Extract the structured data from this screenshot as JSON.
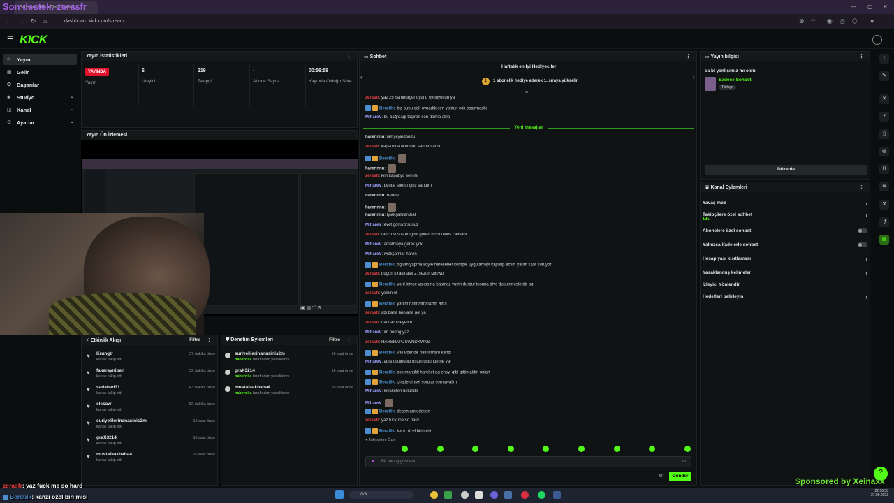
{
  "browser": {
    "tab_title": "Stream - Kick Dashboard",
    "overlay_title": "Son destek: zerasfr",
    "url": "dashboard.kick.com/stream"
  },
  "sidebar": {
    "items": [
      {
        "label": "Yayın"
      },
      {
        "label": "Gelir"
      },
      {
        "label": "Başarılar"
      },
      {
        "label": "Stüdyo"
      },
      {
        "label": "Kanal"
      },
      {
        "label": "Ayarlar"
      }
    ]
  },
  "stats": {
    "title": "Yayın İstatistikleri",
    "live_badge": "YAYINDA",
    "stream_label": "Yayın",
    "viewers_value": "6",
    "viewers_label": "İzleyici",
    "followers_value": "219",
    "followers_label": "Takipçi",
    "subs_value": "-",
    "subs_label": "Abone Sayısı",
    "uptime_value": "00:56:58",
    "uptime_label": "Yayında Olduğu Süre"
  },
  "preview": {
    "title": "Yayın Ön İzlemesi"
  },
  "activity": {
    "title": "Etkinlik Akışı",
    "filter": "Filtre",
    "items": [
      {
        "name": "Krungtr",
        "sub": "kanalı takip etti",
        "time": "37 dakika önce"
      },
      {
        "name": "fakerayniben",
        "sub": "kanalı takip etti",
        "time": "39 dakika önce"
      },
      {
        "name": "sadabed31",
        "sub": "kanalı takip etti",
        "time": "43 dakika önce"
      },
      {
        "name": "clesaw",
        "sub": "kanalı takip etti",
        "time": "52 dakika önce"
      },
      {
        "name": "suriyelilerinanasinis2m",
        "sub": "kanalı takip etti",
        "time": "16 saat önce"
      },
      {
        "name": "graX3214",
        "sub": "kanalı takip etti",
        "time": "16 saat önce"
      },
      {
        "name": "mustafaakbaba4",
        "sub": "kanalı takip etti",
        "time": "16 saat önce"
      }
    ]
  },
  "moderation": {
    "title": "Denetim Eylemleri",
    "filter": "Filtre",
    "items": [
      {
        "name": "suriyelilerinanasinis2m",
        "by": "naberdila",
        "action": "tarafından yasaklandı",
        "time": "16 saat önce"
      },
      {
        "name": "graX3214",
        "by": "naberdila",
        "action": "tarafından yasaklandı",
        "time": "16 saat önce"
      },
      {
        "name": "mustafaakbaba4",
        "by": "naberdila",
        "action": "tarafından yasaklandı",
        "time": "16 saat önce"
      }
    ]
  },
  "chat": {
    "title": "Sohbet",
    "top_gifters_title": "Haftalık en İyi Hediyeciler",
    "top_gifters_sub": "1 abonelik hediye ederek 1. sıraya yükselin",
    "new_messages": "Yeni mesajlar",
    "messages": [
      {
        "user": "zerasfr",
        "color": "#e04040",
        "text": ": yaz 25 hamburger oyunu oynuyosun ya",
        "badges": 0
      },
      {
        "user": "Beratilk",
        "color": "#4c8ed0",
        "text": ": biz bunu cok oynadık sen yoktun cok cagirmadik",
        "badges": 2
      },
      {
        "user": "MihareV",
        "color": "#9aa0ff",
        "text": ": bu bağrdağı taşıran son damla abla",
        "badges": 0
      },
      {
        "user": "harennnn",
        "color": "#cfd2d4",
        "text": ": iamyeyindondu",
        "badges": 0
      },
      {
        "user": "zerasfr",
        "color": "#e04040",
        "text": ": kapatınca aklından sandım amk",
        "badges": 0
      },
      {
        "user": "Beratilk",
        "color": "#4c8ed0",
        "text": ":",
        "badges": 2
      },
      {
        "user": "harennnn",
        "color": "#cfd2d4",
        "text": ":",
        "badges": 0
      },
      {
        "user": "zerasfr",
        "color": "#e04040",
        "text": ": kim kapatiyo sen mi",
        "badges": 0
      },
      {
        "user": "MihareV",
        "color": "#9aa0ff",
        "text": ": bende sıkıntı çıktı sandım",
        "badges": 0
      },
      {
        "user": "harennnn",
        "color": "#cfd2d4",
        "text": ": Bende",
        "badges": 0
      },
      {
        "user": "harennnn",
        "color": "#cfd2d4",
        "text": ":",
        "badges": 0
      },
      {
        "user": "harennnn",
        "color": "#cfd2d4",
        "text": ": İyiakşamlarchat",
        "badges": 0
      },
      {
        "user": "MihareV",
        "color": "#9aa0ff",
        "text": ": evet görüyorsunuz",
        "badges": 0
      },
      {
        "user": "zerasfr",
        "color": "#e04040",
        "text": ": ranch sos istediğimi goren mcdonalds calisani",
        "badges": 0
      },
      {
        "user": "MihareV",
        "color": "#9aa0ff",
        "text": ": anlatmaya gerek yok",
        "badges": 0
      },
      {
        "user": "MihareV",
        "color": "#9aa0ff",
        "text": ": iyiakşamlar haren",
        "badges": 0
      },
      {
        "user": "Beratilk",
        "color": "#4c8ed0",
        "text": ": oglum yapma soyle hareketler komple uygulamayi kapatip actim yarim saat suruyor",
        "badges": 2
      },
      {
        "user": "zerasfr",
        "color": "#e04040",
        "text": ": bugun kıraklı ask 2. sezon izlicwö",
        "badges": 0
      },
      {
        "user": "Beratilk",
        "color": "#4c8ed0",
        "text": ": yarıl kimse yakasına basmaz yayin durdur tusuna diye dusunmuslerdir aq",
        "badges": 2
      },
      {
        "user": "zerasfr",
        "color": "#e04040",
        "text": ": yemin et",
        "badges": 0
      },
      {
        "user": "Beratilk",
        "color": "#4c8ed0",
        "text": ": yapim hatirlatmalazim ama",
        "badges": 2
      },
      {
        "user": "zerasfr",
        "color": "#e04040",
        "text": ": abi bana bunlarla gel ya",
        "badges": 0
      },
      {
        "user": "zerasfr",
        "color": "#e04040",
        "text": ": hadi ac izleyelim",
        "badges": 0
      },
      {
        "user": "MihareV",
        "color": "#9aa0ff",
        "text": ": im boring yaz",
        "badges": 0
      },
      {
        "user": "zerasfr",
        "color": "#e04040",
        "text": ": HAHSHAPDŞWNDKWKS",
        "badges": 0
      },
      {
        "user": "Beratilk",
        "color": "#4c8ed0",
        "text": ": valla bende hatirismam kanzi",
        "badges": 2
      },
      {
        "user": "MihareV",
        "color": "#9aa0ff",
        "text": ": abla üstündeki üstün üstünde ne var",
        "badges": 0
      },
      {
        "user": "Beratilk",
        "color": "#4c8ed0",
        "text": ": cok mantikli hareket aq ensyi gibi gittin aldin onlari",
        "badges": 2
      },
      {
        "user": "Beratilk",
        "color": "#4c8ed0",
        "text": ": chatte cinsel sorular sormayalim",
        "badges": 2
      },
      {
        "user": "MihareV",
        "color": "#9aa0ff",
        "text": ": loyalteten üstünde",
        "badges": 0
      },
      {
        "user": "MihareV",
        "color": "#9aa0ff",
        "text": ":",
        "badges": 0
      },
      {
        "user": "Beratilk",
        "color": "#4c8ed0",
        "text": ": desen amk desen",
        "badges": 2
      },
      {
        "user": "zerasfr",
        "color": "#e04040",
        "text": ": yaz fuck me so hard",
        "badges": 0
      },
      {
        "user": "Beratilk",
        "color": "#4c8ed0",
        "text": ": kanzi özel biri misi",
        "badges": 2
      }
    ],
    "followers_only": "Takipçilere Özel",
    "input_placeholder": "Bir mesaj gönderin",
    "send": "Gönder"
  },
  "stream_info": {
    "title": "Yayın bilgisi",
    "stream_title": "sa bi yanlışımız mı oldu",
    "category": "Sadece Sohbet",
    "language": "Türkçe",
    "edit": "Düzenle"
  },
  "channel_actions": {
    "title": "Kanal Eylemleri",
    "items": [
      {
        "label": "Yavaş mod",
        "control": "arrow"
      },
      {
        "label": "Takipçilere özel sohbet",
        "sub": "1dk.",
        "control": "arrow"
      },
      {
        "label": "Abonelere özel sohbet",
        "control": "toggle"
      },
      {
        "label": "Yalnızca ifadelerle sohbet",
        "control": "toggle"
      },
      {
        "label": "Hesap yaşı kısıtlaması",
        "control": "arrow"
      },
      {
        "label": "Yasaklanmış kelimeler",
        "control": "arrow"
      },
      {
        "label": "İzleyici Yönlendir",
        "control": "none"
      },
      {
        "label": "Hedefleri belirleyin",
        "control": "arrow"
      }
    ]
  },
  "overlay": {
    "chat1_user": "zerasfr",
    "chat1_text": ": yaz fuck me so hard",
    "chat2_user": "Beratilk",
    "chat2_text": ": kanzi özel biri misi",
    "sponsor": "Sponsored by Xeinaxx"
  },
  "taskbar": {
    "search": "Ara",
    "time": "22:36:38",
    "date": "27.09.2023"
  }
}
